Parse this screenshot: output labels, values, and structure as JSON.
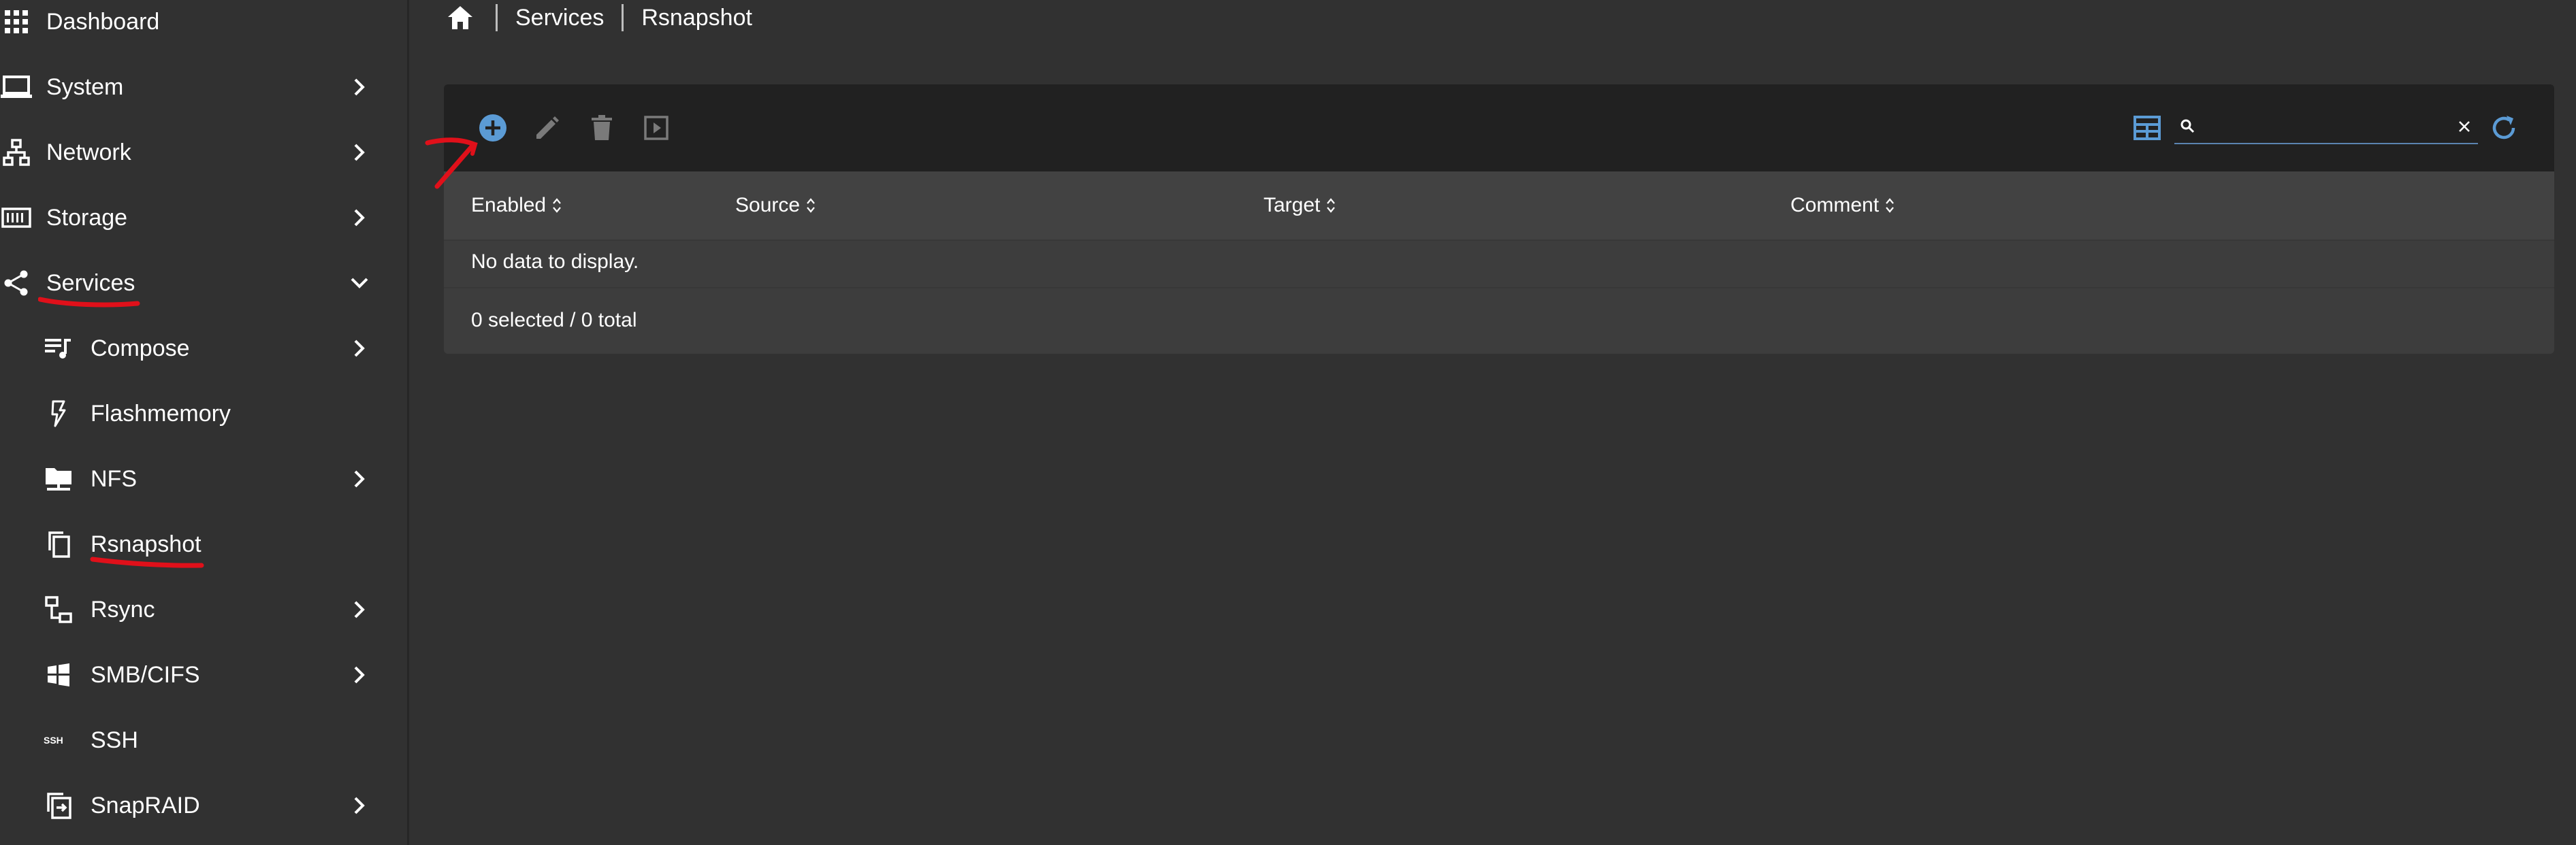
{
  "sidebar": {
    "items": [
      {
        "label": "Dashboard",
        "icon": "grid-icon"
      },
      {
        "label": "System",
        "icon": "laptop-icon"
      },
      {
        "label": "Network",
        "icon": "network-icon"
      },
      {
        "label": "Storage",
        "icon": "storage-icon"
      },
      {
        "label": "Services",
        "icon": "share-icon"
      },
      {
        "label": "Compose",
        "icon": "compose-icon"
      },
      {
        "label": "Flashmemory",
        "icon": "flash-icon"
      },
      {
        "label": "NFS",
        "icon": "folder-network-icon"
      },
      {
        "label": "Rsnapshot",
        "icon": "copy-icon"
      },
      {
        "label": "Rsync",
        "icon": "rsync-icon"
      },
      {
        "label": "SMB/CIFS",
        "icon": "windows-icon"
      },
      {
        "label": "SSH",
        "icon": "ssh-icon"
      },
      {
        "label": "SnapRAID",
        "icon": "snapraid-icon"
      }
    ]
  },
  "breadcrumb": {
    "items": [
      "Services",
      "Rsnapshot"
    ]
  },
  "toolbar": {
    "search_value": ""
  },
  "table": {
    "columns": [
      "Enabled",
      "Source",
      "Target",
      "Comment"
    ],
    "empty_message": "No data to display.",
    "footer": "0 selected / 0 total"
  },
  "colors": {
    "background": "#313131",
    "toolbar": "#212121",
    "table_header": "#424242",
    "accent": "#5b9bd5",
    "annotation": "#e0101a"
  }
}
